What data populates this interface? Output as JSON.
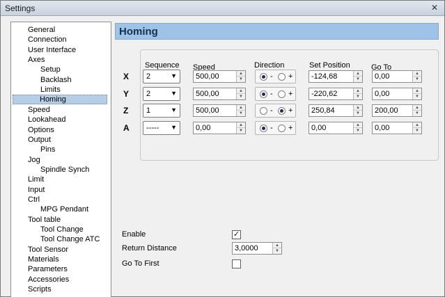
{
  "window": {
    "title": "Settings",
    "close_glyph": "✕"
  },
  "tree": {
    "items": [
      {
        "label": "General",
        "level": 0
      },
      {
        "label": "Connection",
        "level": 0
      },
      {
        "label": "User Interface",
        "level": 0
      },
      {
        "label": "Axes",
        "level": 0
      },
      {
        "label": "Setup",
        "level": 1
      },
      {
        "label": "Backlash",
        "level": 1
      },
      {
        "label": "Limits",
        "level": 1
      },
      {
        "label": "Homing",
        "level": 1,
        "selected": true
      },
      {
        "label": "Speed",
        "level": 0
      },
      {
        "label": "Lookahead",
        "level": 0
      },
      {
        "label": "Options",
        "level": 0
      },
      {
        "label": "Output",
        "level": 0
      },
      {
        "label": "Pins",
        "level": 1
      },
      {
        "label": "Jog",
        "level": 0
      },
      {
        "label": "Spindle Synch",
        "level": 1
      },
      {
        "label": "Limit",
        "level": 0
      },
      {
        "label": "Input",
        "level": 0
      },
      {
        "label": "Ctrl",
        "level": 0
      },
      {
        "label": "MPG Pendant",
        "level": 1
      },
      {
        "label": "Tool table",
        "level": 0
      },
      {
        "label": "Tool Change",
        "level": 1
      },
      {
        "label": "Tool Change ATC",
        "level": 1
      },
      {
        "label": "Tool Sensor",
        "level": 0
      },
      {
        "label": "Materials",
        "level": 0
      },
      {
        "label": "Parameters",
        "level": 0
      },
      {
        "label": "Accessories",
        "level": 0
      },
      {
        "label": "Scripts",
        "level": 0
      }
    ]
  },
  "homing": {
    "title": "Homing",
    "columns": {
      "sequence": "Sequence",
      "speed": "Speed",
      "direction": "Direction",
      "set_position": "Set Position",
      "go_to": "Go To"
    },
    "direction_minus": "-",
    "direction_plus": "+",
    "rows": [
      {
        "axis": "X",
        "sequence": "2",
        "speed": "500,00",
        "dir_minus": true,
        "set_position": "-124,68",
        "go_to": "0,00"
      },
      {
        "axis": "Y",
        "sequence": "2",
        "speed": "500,00",
        "dir_minus": true,
        "set_position": "-220,62",
        "go_to": "0,00"
      },
      {
        "axis": "Z",
        "sequence": "1",
        "speed": "500,00",
        "dir_minus": false,
        "set_position": "250,84",
        "go_to": "200,00"
      },
      {
        "axis": "A",
        "sequence": "-----",
        "speed": "0,00",
        "dir_minus": true,
        "set_position": "0,00",
        "go_to": "0,00"
      }
    ],
    "enable_label": "Enable",
    "enable_checked": true,
    "return_distance_label": "Return Distance",
    "return_distance": "3,0000",
    "go_to_first_label": "Go To First",
    "go_to_first_checked": false,
    "check_glyph": "✓"
  }
}
